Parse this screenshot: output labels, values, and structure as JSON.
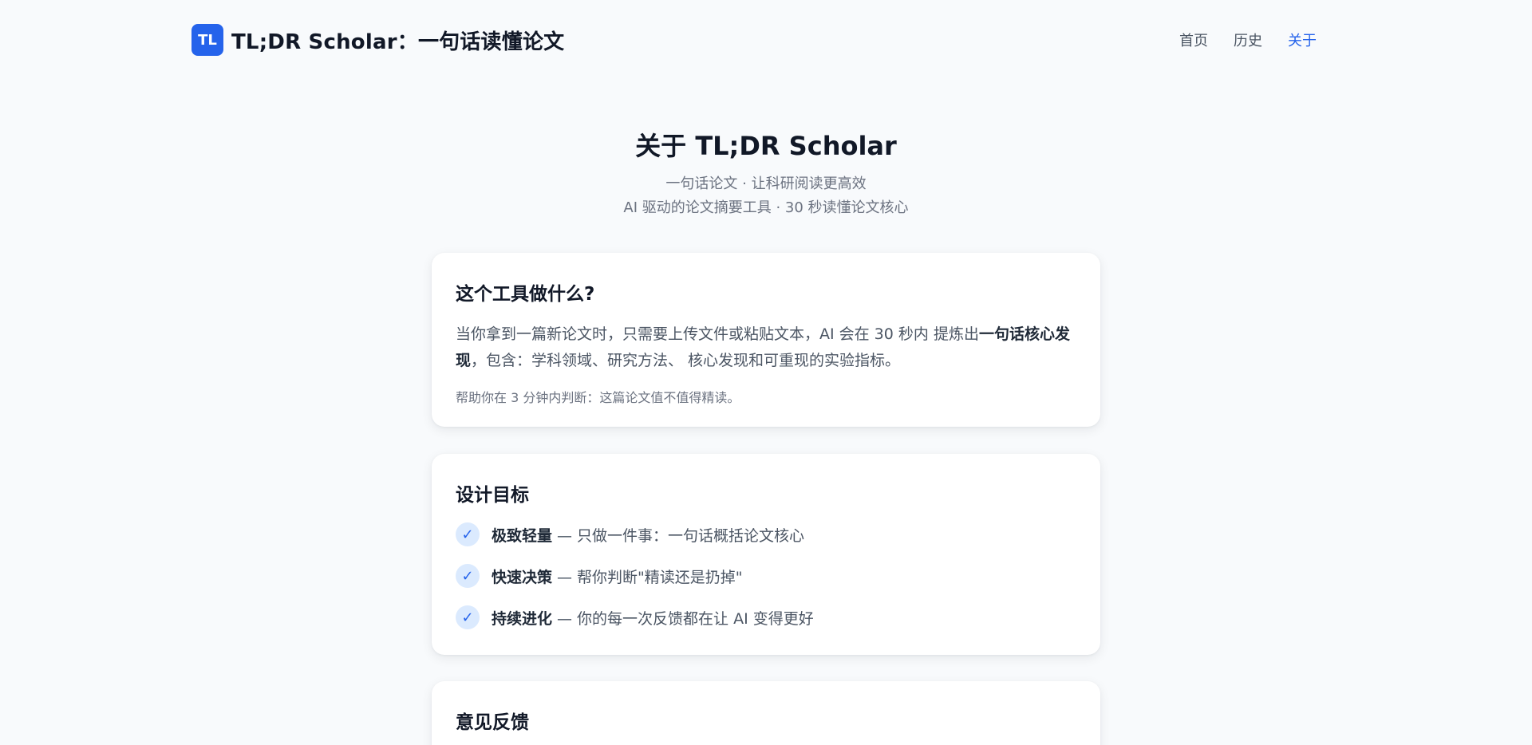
{
  "header": {
    "logo_text": "TL",
    "title": "TL;DR Scholar：一句话读懂论文",
    "nav": [
      {
        "label": "首页",
        "active": false
      },
      {
        "label": "历史",
        "active": false
      },
      {
        "label": "关于",
        "active": true
      }
    ]
  },
  "hero": {
    "title": "关于 TL;DR Scholar",
    "subtitle_1": "一句话论文 · 让科研阅读更高效",
    "subtitle_2": "AI 驱动的论文摘要工具 · 30 秒读懂论文核心"
  },
  "what": {
    "title": "这个工具做什么?",
    "desc_part1": "当你拿到一篇新论文时，只需要上传文件或粘贴文本，AI 会在 30 秒内 提炼出",
    "desc_bold": "一句话核心发现",
    "desc_part2": "，包含：学科领域、研究方法、 核心发现和可重现的实验指标。",
    "note": "帮助你在 3 分钟内判断：这篇论文值不值得精读。"
  },
  "goals": {
    "title": "设计目标",
    "items": [
      {
        "check": "✓",
        "bold": "极致轻量",
        "text": "— 只做一件事：一句话概括论文核心"
      },
      {
        "check": "✓",
        "bold": "快速决策",
        "text": "— 帮你判断\"精读还是扔掉\""
      },
      {
        "check": "✓",
        "bold": "持续进化",
        "text": "— 你的每一次反馈都在让 AI 变得更好"
      }
    ]
  },
  "feedback": {
    "title": "意见反馈"
  },
  "colors": {
    "accent": "#2563eb",
    "background": "#f8fafc",
    "check_bg": "#dbeafe"
  }
}
